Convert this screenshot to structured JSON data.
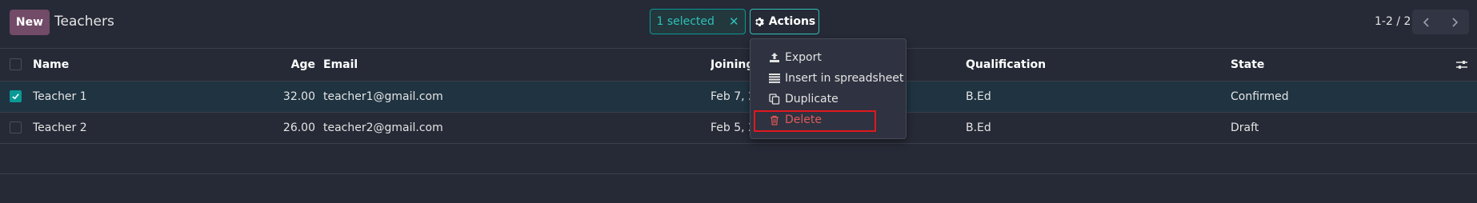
{
  "topbar": {
    "new_label": "New",
    "title": "Teachers",
    "selected_label": "1 selected",
    "clear_selection_glyph": "✕",
    "actions_label": "Actions",
    "pager_value": "1-2 / 2"
  },
  "table": {
    "columns": {
      "name": "Name",
      "age": "Age",
      "email": "Email",
      "joining": "Joining",
      "qualification": "Qualification",
      "state": "State"
    },
    "rows": [
      {
        "name": "Teacher 1",
        "age": "32.00",
        "email": "teacher1@gmail.com",
        "joining": "Feb 7, 2",
        "qualification": "B.Ed",
        "state": "Confirmed",
        "selected": true
      },
      {
        "name": "Teacher 2",
        "age": "26.00",
        "email": "teacher2@gmail.com",
        "joining": "Feb 5, 2",
        "qualification": "B.Ed",
        "state": "Draft",
        "selected": false
      }
    ]
  },
  "actions_menu": {
    "items": [
      {
        "label": "Export",
        "icon": "upload-icon"
      },
      {
        "label": "Insert in spreadsheet",
        "icon": "list-icon"
      },
      {
        "label": "Duplicate",
        "icon": "copy-icon"
      },
      {
        "label": "Delete",
        "icon": "trash-icon"
      }
    ]
  },
  "colors": {
    "background": "#262a36",
    "brand": "#714b67",
    "accent": "#0a9a96",
    "danger": "#e05a5a",
    "highlight_box": "#e0181e"
  }
}
